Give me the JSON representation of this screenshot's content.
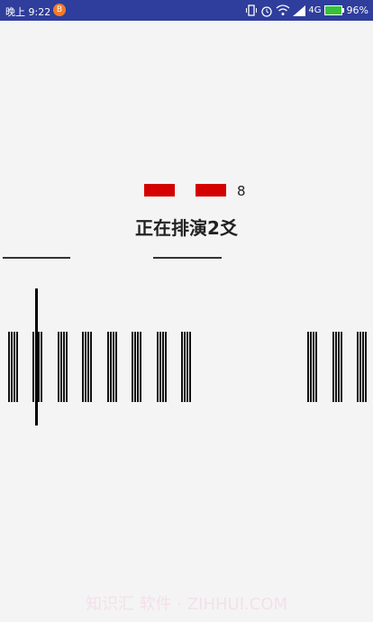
{
  "status_bar": {
    "time": "晚上 9:22",
    "app_badge": "B",
    "network": "4G",
    "battery": "96%",
    "icons": [
      "vibrate-icon",
      "alarm-icon",
      "wifi-icon",
      "signal-icon",
      "battery-icon"
    ]
  },
  "hexagram": {
    "count": "8",
    "title": "正在排演2爻",
    "mark_color": "#d40000"
  },
  "sticks": {
    "group_count": 11,
    "lines_per_group": 4
  },
  "watermark": "知识汇  软件 · ZIHHUI.COM"
}
